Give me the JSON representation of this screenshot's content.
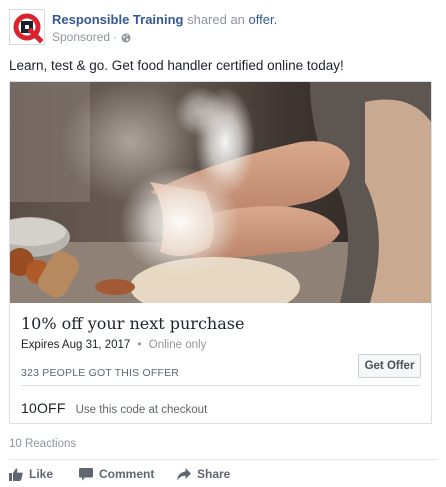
{
  "post": {
    "page_name": "Responsible Training",
    "action_text": "shared an",
    "offer_link": "offer.",
    "sponsored": "Sponsored",
    "separator": "·",
    "audience_icon": "globe-icon",
    "avatar_icon": "responsible-training-logo",
    "message": "Learn, test & go. Get food handler certified online today!"
  },
  "offer": {
    "image_description_icon": "hands-with-flour-photo",
    "title": "10% off your next purchase",
    "expires": "Expires Aug 31, 2017",
    "dot": "•",
    "availability": "Online only",
    "claimed": "323 PEOPLE GOT THIS OFFER",
    "button_label": "Get Offer",
    "code": "10OFF",
    "code_hint": "Use this code at checkout"
  },
  "footer": {
    "reactions": "10 Reactions",
    "actions": [
      {
        "label": "Like",
        "icon": "thumbs-up-icon"
      },
      {
        "label": "Comment",
        "icon": "comment-icon"
      },
      {
        "label": "Share",
        "icon": "share-arrow-icon"
      }
    ]
  },
  "colors": {
    "link": "#365899",
    "muted": "#90949c",
    "text": "#1d2129",
    "logo_red": "#d9232e"
  }
}
